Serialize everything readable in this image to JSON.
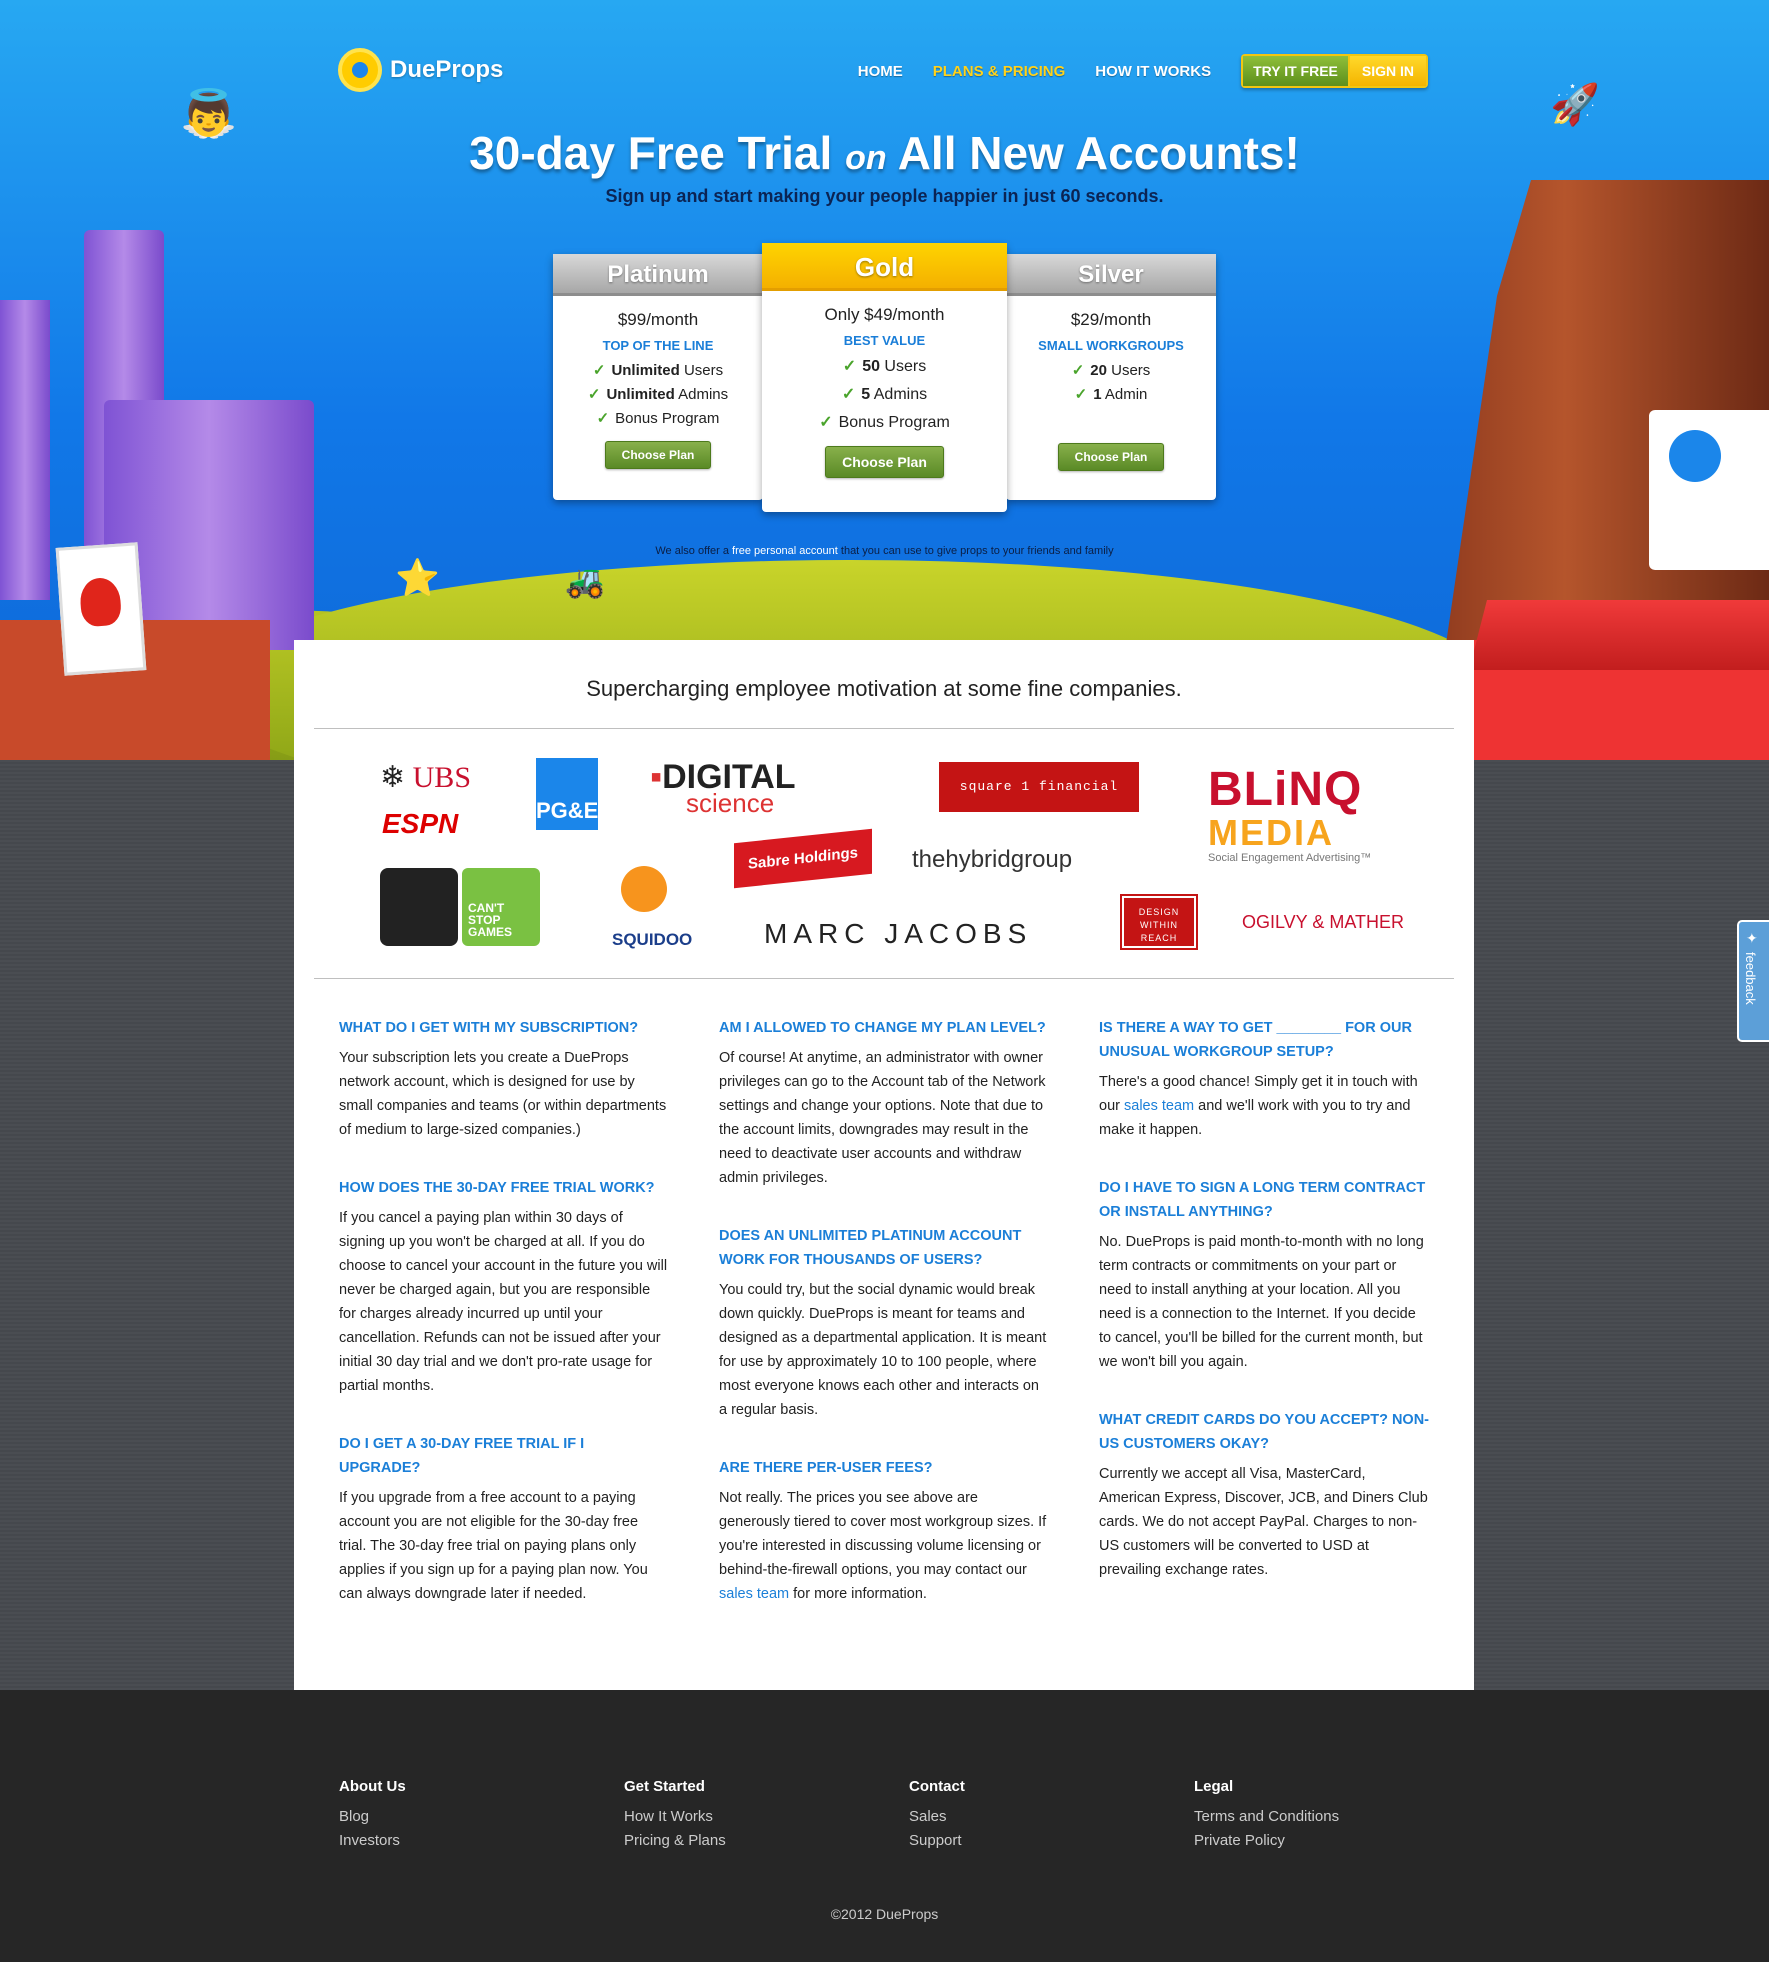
{
  "nav": {
    "logo_text": "DueProps",
    "links": [
      "HOME",
      "PLANS & PRICING",
      "HOW IT WORKS"
    ],
    "try_label": "TRY IT FREE",
    "signin_label": "SIGN IN"
  },
  "hero": {
    "headline_1": "30-day Free Trial",
    "headline_on": "on",
    "headline_2": "All New Accounts!",
    "subhead": "Sign up and start making your people happier in just 60 seconds.",
    "also_pre": "We also offer a",
    "also_link": "free personal account",
    "also_post": "that you can use to give props to your friends and family"
  },
  "plans": [
    {
      "name": "Platinum",
      "price": "$99/month",
      "tag": "TOP OF THE LINE",
      "features": [
        {
          "b": "Unlimited",
          "t": " Users"
        },
        {
          "b": "Unlimited",
          "t": " Admins"
        },
        {
          "b": "",
          "t": "Bonus Program"
        }
      ],
      "button": "Choose Plan"
    },
    {
      "name": "Gold",
      "price": "Only $49/month",
      "tag": "BEST VALUE",
      "features": [
        {
          "b": "50",
          "t": " Users"
        },
        {
          "b": "5",
          "t": " Admins"
        },
        {
          "b": "",
          "t": "Bonus Program"
        }
      ],
      "button": "Choose Plan"
    },
    {
      "name": "Silver",
      "price": "$29/month",
      "tag": "SMALL WORKGROUPS",
      "features": [
        {
          "b": "20",
          "t": " Users"
        },
        {
          "b": "1",
          "t": " Admin"
        }
      ],
      "button": "Choose Plan"
    }
  ],
  "companies": {
    "tagline": "Supercharging employee motivation at some fine companies.",
    "logos": [
      "UBS",
      "ESPN",
      "PG&E",
      "DIGITAL",
      "science",
      "square 1 financial",
      "BLiNQ",
      "MEDIA",
      "Social Engagement Advertising™",
      "CAN'T STOP GAMES",
      "SQUIDOO",
      "Sabre Holdings",
      "thehybridgroup",
      "MARC JACOBS",
      "DESIGN WITHIN REACH",
      "OGILVY & MATHER"
    ]
  },
  "faq": {
    "col1": [
      {
        "q": "What do I get with my subscription?",
        "a": "Your subscription lets you create a DueProps network account, which is designed for use by small companies and teams (or within departments of medium to large-sized companies.)"
      },
      {
        "q": "How does the 30-day free trial work?",
        "a": "If you cancel a paying plan within 30 days of signing up you won't be charged at all. If you do choose to cancel your account in the future you will never be charged again, but you are responsible for charges already incurred up until your cancellation. Refunds can not be issued after your initial 30 day trial and we don't pro-rate usage for partial months."
      },
      {
        "q": "Do I get a 30-day free trial if I upgrade?",
        "a": "If you upgrade from a free account to a paying account you are not eligible for the 30-day free trial. The 30-day free trial on paying plans only applies if you sign up for a paying plan now. You can always downgrade later if needed."
      }
    ],
    "col2": [
      {
        "q": "Am I allowed to change my plan level?",
        "a": "Of course! At anytime, an administrator with owner privileges can go to the Account tab of the Network settings and change your options. Note that due to the account limits, downgrades may result in the need to deactivate user accounts and withdraw admin privileges."
      },
      {
        "q": "Does an Unlimited Platinum account work for thousands of users?",
        "a": "You could try, but the social dynamic would break down quickly. DueProps is meant for teams and designed as a departmental application. It is meant for use by approximately 10 to 100 people, where most everyone knows each other and interacts on a regular basis."
      },
      {
        "q": "Are there per-user fees?",
        "a_pre": "Not really. The prices you see above are generously tiered to cover most workgroup sizes. If you're interested in discussing volume licensing or behind-the-firewall options, you may contact our",
        "a_link": "sales team",
        "a_post": "for more information."
      }
    ],
    "col3": [
      {
        "q": "Is there a way to get ________ for our unusual workgroup setup?",
        "a_pre": "There's a good chance! Simply get it in touch with our",
        "a_link": "sales team",
        "a_post": "and we'll work with you to try and make it happen."
      },
      {
        "q": "Do I have to sign a long term contract or install anything?",
        "a": "No. DueProps is paid month-to-month with no long term contracts or commitments on your part or need to install anything at your location. All you need is a connection to the Internet. If you decide to cancel, you'll be billed for the current month, but we won't bill you again."
      },
      {
        "q": "What credit cards do you accept? Non-US customers okay?",
        "a": "Currently we accept all Visa, MasterCard, American Express, Discover, JCB, and Diners Club cards. We do not accept PayPal. Charges to non-US customers will be converted to USD at prevailing exchange rates."
      }
    ]
  },
  "feedback_label": "feedback",
  "footer": {
    "cols": [
      {
        "heading": "About Us",
        "links": [
          "Blog",
          "Investors"
        ]
      },
      {
        "heading": "Get Started",
        "links": [
          "How It Works",
          "Pricing & Plans"
        ]
      },
      {
        "heading": "Contact",
        "links": [
          "Sales",
          "Support"
        ]
      },
      {
        "heading": "Legal",
        "links": [
          "Terms and Conditions",
          "Private Policy"
        ]
      }
    ],
    "copyright": "©2012 DueProps"
  },
  "colors": {
    "accent_blue": "#1b7fd8",
    "gold": "#ffd400",
    "green_button": "#5a8a26",
    "nav_active": "#ffd21a"
  }
}
